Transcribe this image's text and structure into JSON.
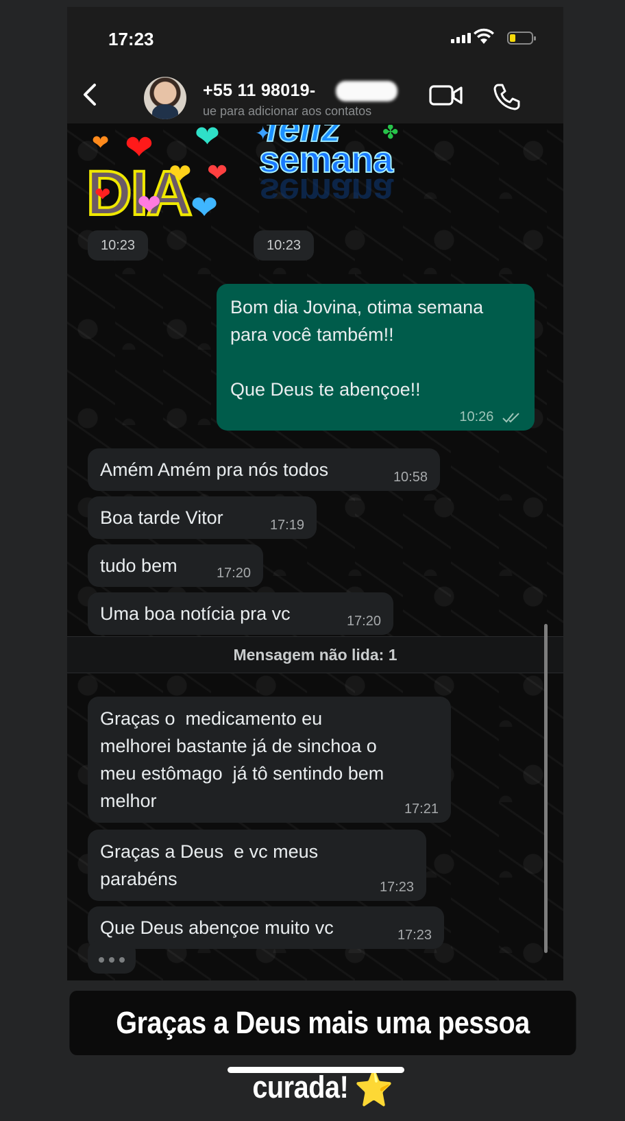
{
  "status_bar": {
    "time": "17:23"
  },
  "header": {
    "back_icon": "chevron-left-icon",
    "contact_name": "+55 11 98019-",
    "contact_subtitle": "ue para adicionar aos contatos",
    "video_icon": "video-camera-icon",
    "call_icon": "phone-icon"
  },
  "stickers": [
    {
      "art_text": "DIA",
      "time": "10:23"
    },
    {
      "art_text": "semana",
      "time": "10:23"
    }
  ],
  "messages": [
    {
      "direction": "out",
      "text": "Bom dia Jovina, otima semana\npara você também!!\n\nQue Deus te abençoe!!",
      "time": "10:26",
      "status": "read"
    },
    {
      "direction": "in",
      "text": "Amém Amém pra nós todos",
      "time": "10:58"
    },
    {
      "direction": "in",
      "text": "Boa tarde Vitor",
      "time": "17:19"
    },
    {
      "direction": "in",
      "text": "tudo bem",
      "time": "17:20"
    },
    {
      "direction": "in",
      "text": "Uma boa notícia pra vc",
      "time": "17:20"
    },
    {
      "direction": "in",
      "text": "Graças o  medicamento eu\nmelhorei bastante já de sinchoa o\nmeu estômago  já tô sentindo bem\nmelhor",
      "time": "17:21"
    },
    {
      "direction": "in",
      "text": "Graças a Deus  e vc meus\nparabéns",
      "time": "17:23"
    },
    {
      "direction": "in",
      "text": "Que Deus abençoe muito vc",
      "time": "17:23"
    }
  ],
  "unread_divider": "Mensagem não lida: 1",
  "caption": {
    "text": "Graças a Deus mais uma pessoa curada!",
    "emoji": "⭐"
  },
  "colors": {
    "outgoing_bubble": "#005c4b",
    "incoming_bubble": "#1f2123",
    "background": "#0b0b0b",
    "battery": "#f5d90a"
  }
}
